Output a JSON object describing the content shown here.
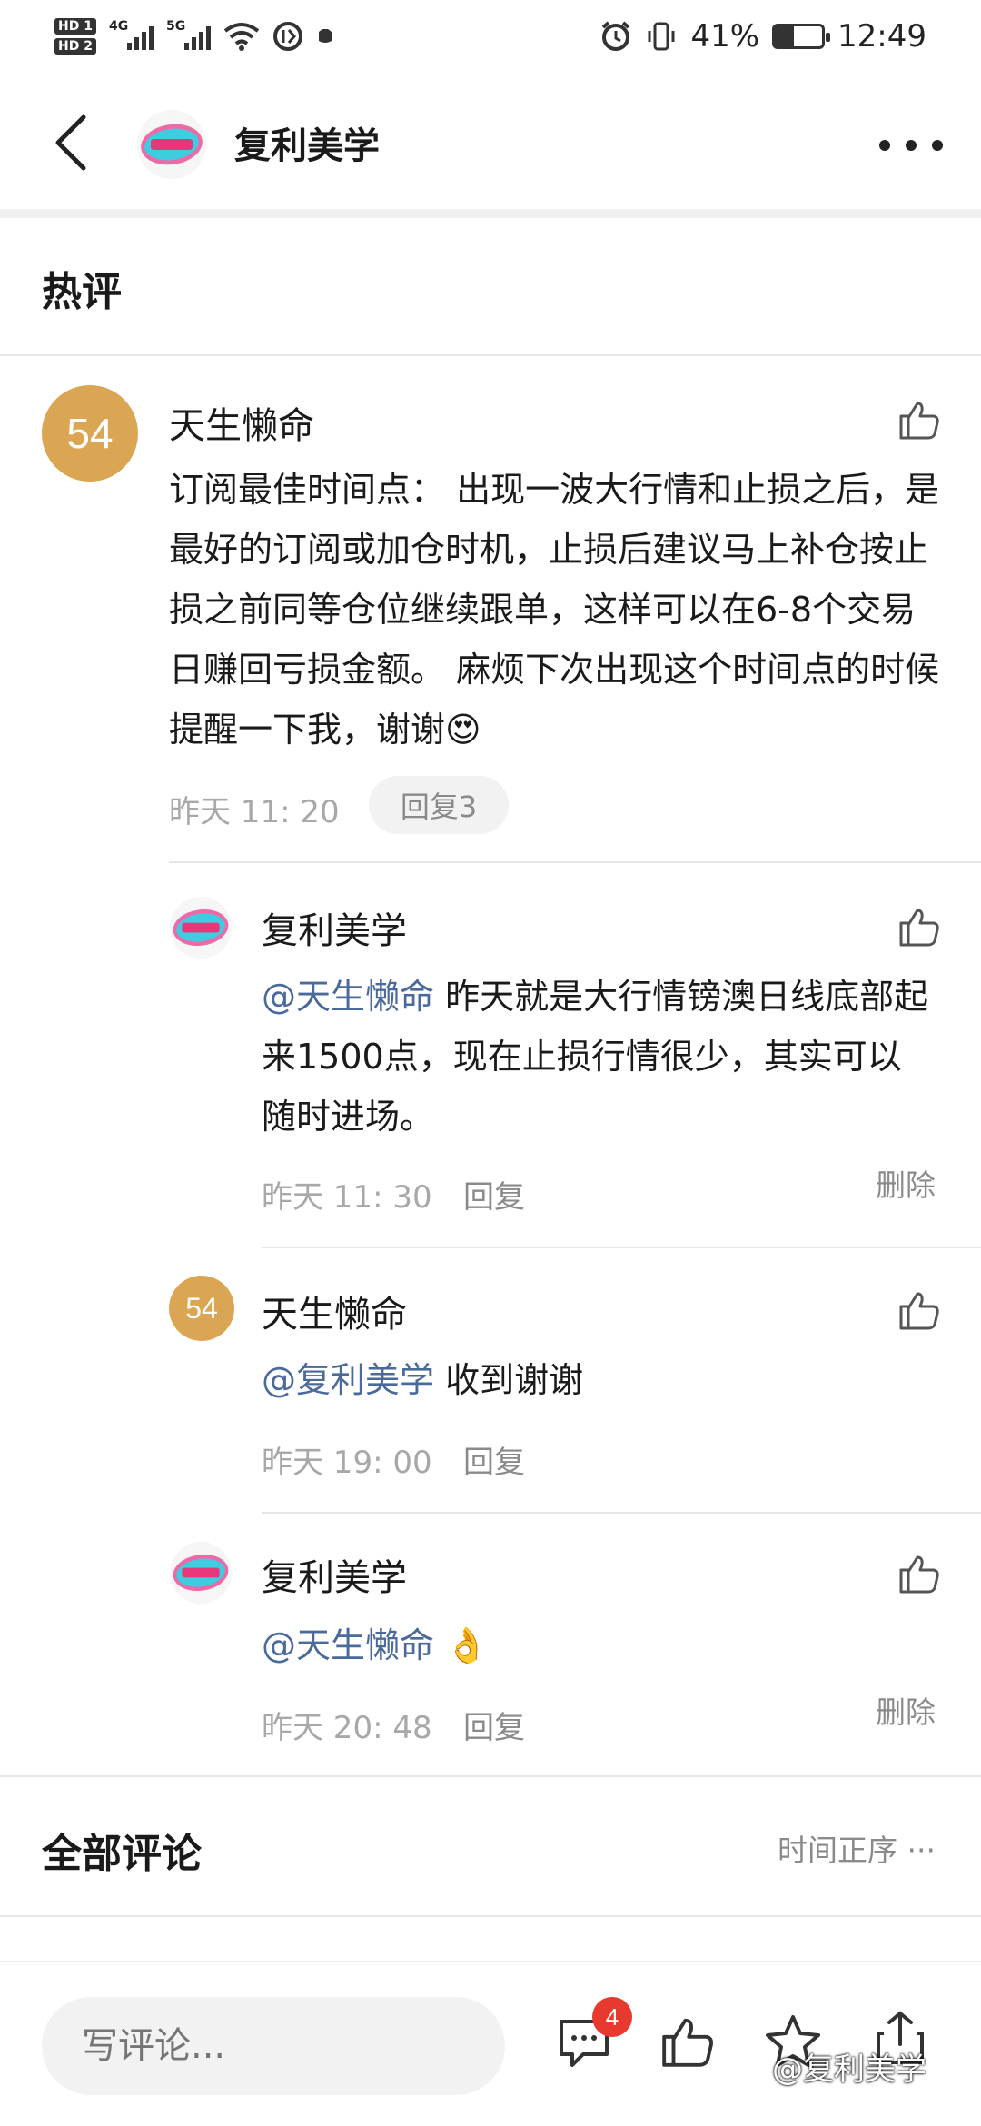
{
  "status": {
    "hd1": "HD 1",
    "hd2": "HD 2",
    "net1": "4G",
    "net2": "5G",
    "battery_percent": "41%",
    "battery_level": 0.41,
    "time": "12:49"
  },
  "header": {
    "title": "复利美学",
    "brand_color": "#3ecde0"
  },
  "hot_section": {
    "title": "热评"
  },
  "comments": [
    {
      "avatar_text": "54",
      "name": "天生懒命",
      "text": "订阅最佳时间点： 出现一波大行情和止损之后，是最好的订阅或加仓时机，止损后建议马上补仓按止损之前同等仓位继续跟单，这样可以在6-8个交易日赚回亏损金额。 麻烦下次出现这个时间点的时候提醒一下我，谢谢😍",
      "time": "昨天 11: 20",
      "reply_count_label": "回复3"
    }
  ],
  "replies": [
    {
      "name": "复利美学",
      "mention": "@天生懒命",
      "text": " 昨天就是大行情镑澳日线底部起来1500点，现在止损行情很少，其实可以随时进场。",
      "time": "昨天 11: 30",
      "reply_label": "回复",
      "delete_label": "删除"
    },
    {
      "avatar_text": "54",
      "name": "天生懒命",
      "mention": "@复利美学",
      "text": " 收到谢谢",
      "time": "昨天 19: 00",
      "reply_label": "回复"
    },
    {
      "name": "复利美学",
      "mention": "@天生懒命",
      "text": " 👌",
      "time": "昨天 20: 48",
      "reply_label": "回复",
      "delete_label": "删除"
    }
  ],
  "all_section": {
    "title": "全部评论",
    "sort_label": "时间正序"
  },
  "bottom": {
    "input_placeholder": "写评论...",
    "comment_badge": "4",
    "watermark": "@复利美学"
  },
  "colors": {
    "avatar_bg": "#dba654",
    "mention": "#4a6a9c",
    "badge": "#e8392f"
  }
}
